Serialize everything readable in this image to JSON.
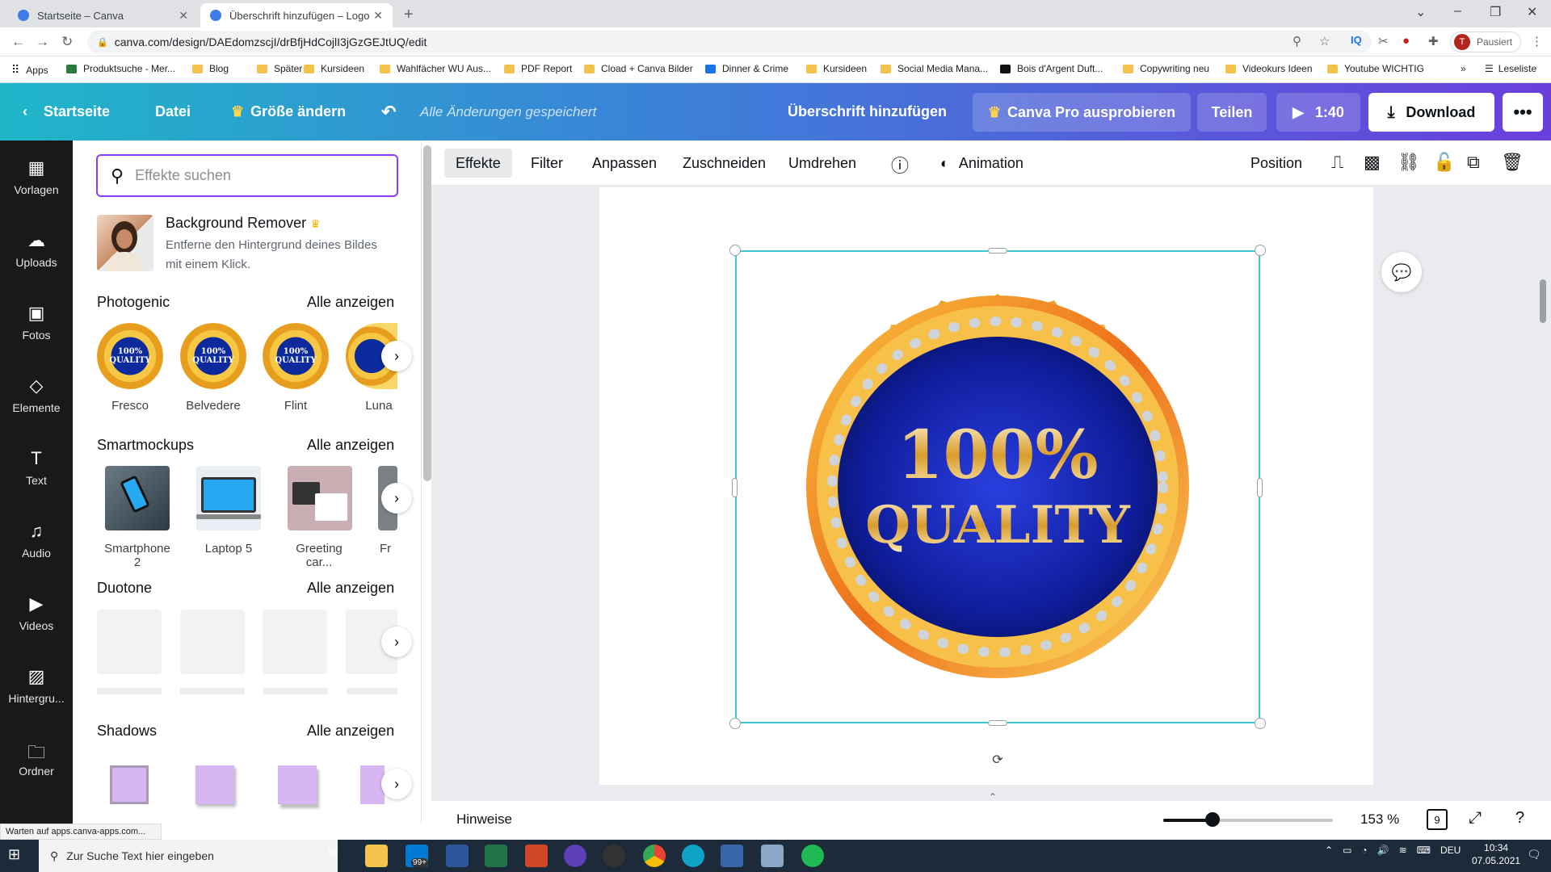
{
  "browser": {
    "tabs": [
      {
        "title": "Startseite – Canva"
      },
      {
        "title": "Überschrift hinzufügen – Logo"
      }
    ],
    "url": "canva.com/design/DAEdomzscjI/drBfjHdCojlI3jGzGEJtUQ/edit",
    "profile_status": "Pausiert",
    "profile_initial": "T",
    "bookmarks": [
      "Apps",
      "Produktsuche - Mer...",
      "Blog",
      "Später",
      "Kursideen",
      "Wahlfächer WU Aus...",
      "PDF Report",
      "Cload + Canva Bilder",
      "Dinner & Crime",
      "Kursideen",
      "Social Media Mana...",
      "Bois d'Argent Duft...",
      "Copywriting neu",
      "Videokurs Ideen",
      "Youtube WICHTIG",
      "Leseliste"
    ]
  },
  "header": {
    "home": "Startseite",
    "file": "Datei",
    "resize": "Größe ändern",
    "saved_status": "Alle Änderungen gespeichert",
    "title": "Überschrift hinzufügen",
    "pro": "Canva Pro ausprobieren",
    "share": "Teilen",
    "play_time": "1:40",
    "download": "Download",
    "more": "•••"
  },
  "rail": [
    "Vorlagen",
    "Uploads",
    "Fotos",
    "Elemente",
    "Text",
    "Audio",
    "Videos",
    "Hintergru...",
    "Ordner"
  ],
  "panel": {
    "search_placeholder": "Effekte suchen",
    "bg_remover_title": "Background Remover",
    "bg_remover_desc": "Entferne den Hintergrund deines Bildes mit einem Klick.",
    "sections": [
      {
        "title": "Photogenic",
        "all": "Alle anzeigen",
        "items": [
          "Fresco",
          "Belvedere",
          "Flint",
          "Luna"
        ]
      },
      {
        "title": "Smartmockups",
        "all": "Alle anzeigen",
        "items": [
          "Smartphone 2",
          "Laptop 5",
          "Greeting car...",
          "Fr"
        ]
      },
      {
        "title": "Duotone",
        "all": "Alle anzeigen"
      },
      {
        "title": "Shadows",
        "all": "Alle anzeigen"
      }
    ],
    "badge_text": "100% QUALITY"
  },
  "toolbar": {
    "effekte": "Effekte",
    "filter": "Filter",
    "anpassen": "Anpassen",
    "zuschneiden": "Zuschneiden",
    "umdrehen": "Umdrehen",
    "animation": "Animation",
    "position": "Position"
  },
  "canvas": {
    "badge_top": "100%",
    "badge_bottom": "QUALITY"
  },
  "bottom": {
    "notes": "Hinweise",
    "zoom": "153 %",
    "zoom_level": 0.29,
    "page_count": "9",
    "status": "Warten auf apps.canva-apps.com..."
  },
  "taskbar": {
    "search": "Zur Suche Text hier eingeben",
    "badge": "99+",
    "lang": "DEU",
    "time": "10:34",
    "date": "07.05.2021"
  },
  "colors": {
    "brand_purple": "#8b3dff",
    "selection": "#3ec9d0",
    "gold": "#f6c743",
    "blue": "#0c2a9c"
  }
}
